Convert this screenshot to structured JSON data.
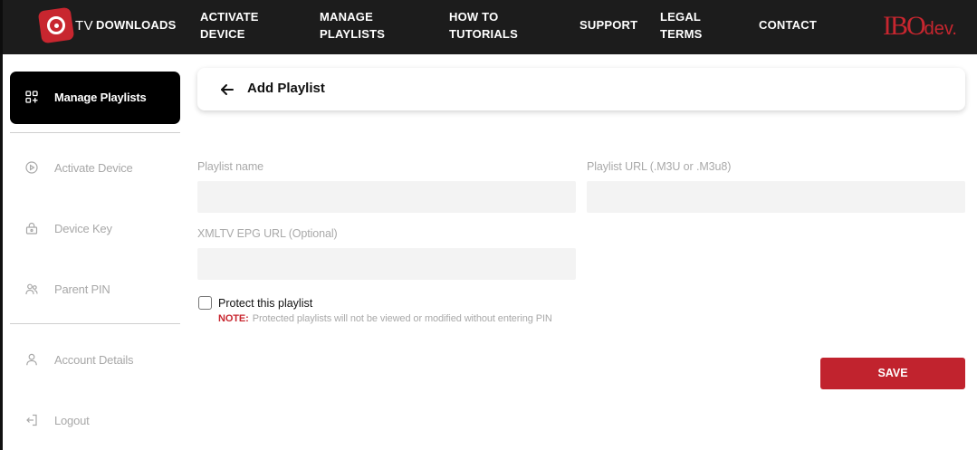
{
  "nav": {
    "logo_text": "TV",
    "links": [
      {
        "label_line1": "DOWNLOADS",
        "label_line2": ""
      },
      {
        "label_line1": "ACTIVATE",
        "label_line2": "DEVICE"
      },
      {
        "label_line1": "MANAGE",
        "label_line2": "PLAYLISTS"
      },
      {
        "label_line1": "HOW TO",
        "label_line2": "TUTORIALS"
      },
      {
        "label_line1": "SUPPORT",
        "label_line2": ""
      },
      {
        "label_line1": "LEGAL",
        "label_line2": "TERMS"
      },
      {
        "label_line1": "CONTACT",
        "label_line2": ""
      }
    ],
    "brand_main": "IBO",
    "brand_suffix": "dev."
  },
  "sidebar": {
    "active": {
      "label": "Manage Playlists",
      "icon": "grid-plus-icon"
    },
    "items": [
      {
        "label": "Activate Device",
        "icon": "play-circle-icon"
      },
      {
        "label": "Device Key",
        "icon": "lock-icon"
      },
      {
        "label": "Parent PIN",
        "icon": "users-icon"
      },
      {
        "label": "Account Details",
        "icon": "user-icon"
      },
      {
        "label": "Logout",
        "icon": "logout-icon"
      }
    ]
  },
  "header": {
    "title": "Add Playlist",
    "back_icon": "arrow-left-icon"
  },
  "form": {
    "playlist_name_label": "Playlist name",
    "playlist_name_value": "",
    "playlist_url_label": "Playlist URL (.M3U or .M3u8)",
    "playlist_url_value": "",
    "epg_label": "XMLTV EPG URL (Optional)",
    "epg_value": "",
    "protect_label": "Protect this playlist",
    "protect_checked": false,
    "note_tag": "NOTE:",
    "note_text": "Protected playlists will not be viewed or modified without entering PIN",
    "save_label": "SAVE"
  },
  "colors": {
    "accent": "#c1232e",
    "nav_bg": "#1c1c1c",
    "active_bg": "#000000",
    "muted_text": "#a9a9a9"
  }
}
